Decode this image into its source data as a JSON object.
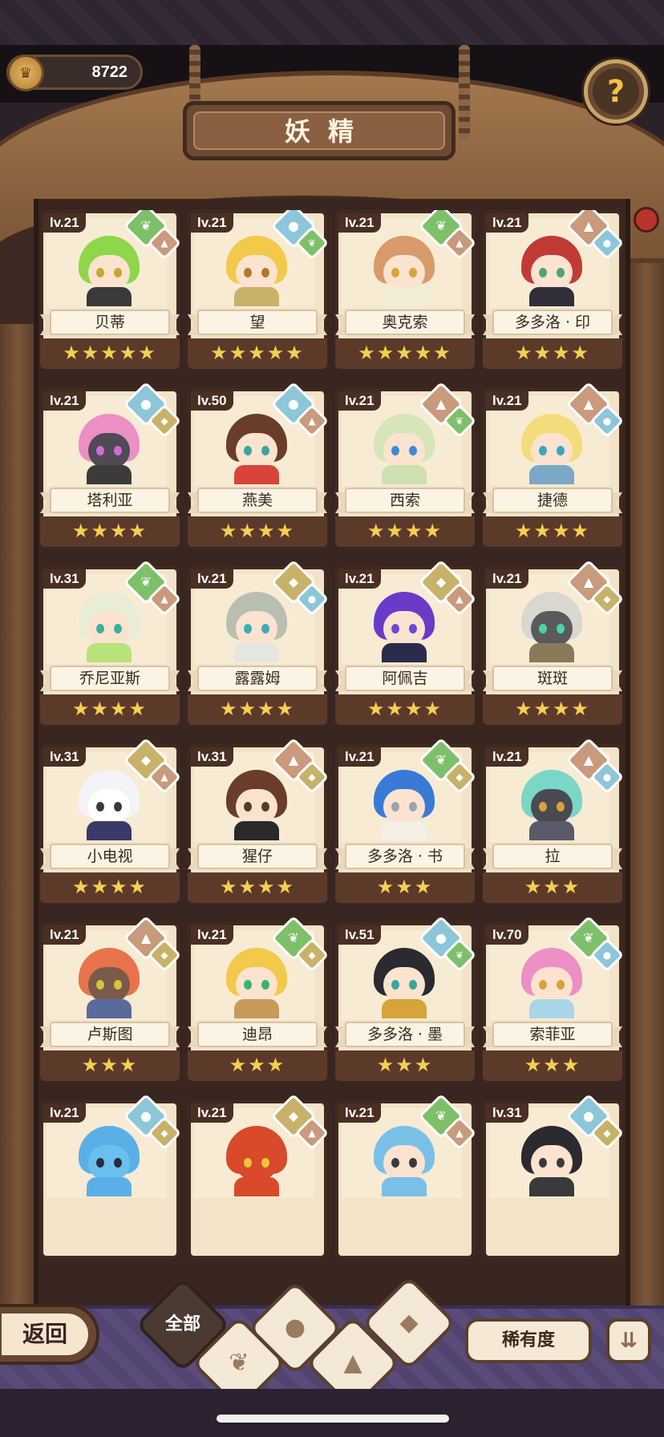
{
  "header": {
    "currency_value": "8722",
    "currency_icon": "crown-coin-icon",
    "title": "妖精",
    "help_icon": "question-sprout-icon"
  },
  "fairies": [
    {
      "name": "贝蒂",
      "level": "lv.21",
      "stars": 5,
      "elements": [
        "green",
        "mountain"
      ],
      "hair": "#8ed64a",
      "skin": "#fbe3cf",
      "eye": "#c9a72c",
      "body": "#3a3a3a"
    },
    {
      "name": "望",
      "level": "lv.21",
      "stars": 5,
      "elements": [
        "blue",
        "green"
      ],
      "hair": "#f2c94a",
      "skin": "#fbe3cf",
      "eye": "#b07a2a",
      "body": "#c8b26a"
    },
    {
      "name": "奥克索",
      "level": "lv.21",
      "stars": 5,
      "elements": [
        "green",
        "mountain"
      ],
      "hair": "#d89a6a",
      "skin": "#fbe3cf",
      "eye": "#d7a43a",
      "body": "#f1ecd6"
    },
    {
      "name": "多多洛 · 印",
      "level": "lv.21",
      "stars": 4,
      "elements": [
        "mountain",
        "blue"
      ],
      "hair": "#c23a36",
      "skin": "#fbe3cf",
      "eye": "#4aa57a",
      "body": "#2f2f3a"
    },
    {
      "name": "塔利亚",
      "level": "lv.21",
      "stars": 4,
      "elements": [
        "blue",
        "earth"
      ],
      "hair": "#ec8fc4",
      "skin": "#4f4a55",
      "eye": "#d36ad8",
      "body": "#3b3b3b"
    },
    {
      "name": "燕美",
      "level": "lv.50",
      "stars": 4,
      "elements": [
        "blue",
        "mountain"
      ],
      "hair": "#6a3d2a",
      "skin": "#fbe3cf",
      "eye": "#3aa5a0",
      "body": "#d8443a"
    },
    {
      "name": "西索",
      "level": "lv.21",
      "stars": 4,
      "elements": [
        "mountain",
        "green"
      ],
      "hair": "#d6e6b8",
      "skin": "#fbe3cf",
      "eye": "#3a8ad6",
      "body": "#cfe0b0"
    },
    {
      "name": "捷德",
      "level": "lv.21",
      "stars": 4,
      "elements": [
        "mountain",
        "blue"
      ],
      "hair": "#f3dc7a",
      "skin": "#fbe3cf",
      "eye": "#3aa5c6",
      "body": "#7aa8c6"
    },
    {
      "name": "乔尼亚斯",
      "level": "lv.31",
      "stars": 4,
      "elements": [
        "green",
        "mountain"
      ],
      "hair": "#e9ecd6",
      "skin": "#fbe3cf",
      "eye": "#3ab0a0",
      "body": "#b8e27a"
    },
    {
      "name": "露露姆",
      "level": "lv.21",
      "stars": 4,
      "elements": [
        "earth",
        "blue"
      ],
      "hair": "#b8bfb0",
      "skin": "#fbe3cf",
      "eye": "#3ab0b0",
      "body": "#e6e6e0"
    },
    {
      "name": "阿佩吉",
      "level": "lv.21",
      "stars": 4,
      "elements": [
        "earth",
        "mountain"
      ],
      "hair": "#6a3ac8",
      "skin": "#fbe3cf",
      "eye": "#6a4ad6",
      "body": "#2a2a4a"
    },
    {
      "name": "斑斑",
      "level": "lv.21",
      "stars": 4,
      "elements": [
        "mountain",
        "earth"
      ],
      "hair": "#d8d8d0",
      "skin": "#5a5a5e",
      "eye": "#4ad6a0",
      "body": "#8a7a5a"
    },
    {
      "name": "小电视",
      "level": "lv.31",
      "stars": 4,
      "elements": [
        "earth",
        "mountain"
      ],
      "hair": "#f4f4f8",
      "skin": "#ffffff",
      "eye": "#3a3a3a",
      "body": "#3a3a6a"
    },
    {
      "name": "猩仔",
      "level": "lv.31",
      "stars": 4,
      "elements": [
        "mountain",
        "earth"
      ],
      "hair": "#6a3d2a",
      "skin": "#fbe3cf",
      "eye": "#5a3a2a",
      "body": "#2a2a2a"
    },
    {
      "name": "多多洛 · 书",
      "level": "lv.21",
      "stars": 3,
      "elements": [
        "green",
        "earth"
      ],
      "hair": "#3a7ad6",
      "skin": "#fbe3cf",
      "eye": "#9aa4b0",
      "body": "#f4f0e6"
    },
    {
      "name": "拉",
      "level": "lv.21",
      "stars": 3,
      "elements": [
        "mountain",
        "blue"
      ],
      "hair": "#7ad6c6",
      "skin": "#4a4a52",
      "eye": "#d6a43a",
      "body": "#5a5a6a"
    },
    {
      "name": "卢斯图",
      "level": "lv.21",
      "stars": 3,
      "elements": [
        "mountain",
        "earth"
      ],
      "hair": "#e8734a",
      "skin": "#7a5a4a",
      "eye": "#d6c43a",
      "body": "#5a6a9a"
    },
    {
      "name": "迪昂",
      "level": "lv.21",
      "stars": 3,
      "elements": [
        "green",
        "earth"
      ],
      "hair": "#f2c94a",
      "skin": "#fbe3cf",
      "eye": "#3ab07a",
      "body": "#c89a5a"
    },
    {
      "name": "多多洛 · 墨",
      "level": "lv.51",
      "stars": 3,
      "elements": [
        "blue",
        "green"
      ],
      "hair": "#2a2a30",
      "skin": "#fbe3cf",
      "eye": "#3aa5a0",
      "body": "#d6a43a"
    },
    {
      "name": "索菲亚",
      "level": "lv.70",
      "stars": 3,
      "elements": [
        "green",
        "blue"
      ],
      "hair": "#ec8fc4",
      "skin": "#fbe3cf",
      "eye": "#d6a43a",
      "body": "#a8d6e6"
    },
    {
      "name": "",
      "level": "lv.21",
      "stars": 0,
      "elements": [
        "blue",
        "earth"
      ],
      "hair": "#5ab0e6",
      "skin": "#6ac0ec",
      "eye": "#2a2a3a",
      "body": "#5ab0e6"
    },
    {
      "name": "",
      "level": "lv.21",
      "stars": 0,
      "elements": [
        "earth",
        "mountain"
      ],
      "hair": "#d84a2a",
      "skin": "#d84a2a",
      "eye": "#f4c43a",
      "body": "#d84a2a"
    },
    {
      "name": "",
      "level": "lv.21",
      "stars": 0,
      "elements": [
        "green",
        "mountain"
      ],
      "hair": "#7ac0e6",
      "skin": "#fbe3cf",
      "eye": "#3a3a3a",
      "body": "#7ac0e6"
    },
    {
      "name": "",
      "level": "lv.31",
      "stars": 0,
      "elements": [
        "blue",
        "earth"
      ],
      "hair": "#2a2a30",
      "skin": "#fbe3cf",
      "eye": "#3a3a3a",
      "body": "#3a3a3a"
    }
  ],
  "footer": {
    "back_label": "返回",
    "filter_all_label": "全部",
    "filters": [
      "sprout-icon",
      "water-drop-icon",
      "mountain-icon",
      "rock-icon"
    ],
    "rarity_label": "稀有度",
    "sort_icon": "sort-descending-icon"
  }
}
